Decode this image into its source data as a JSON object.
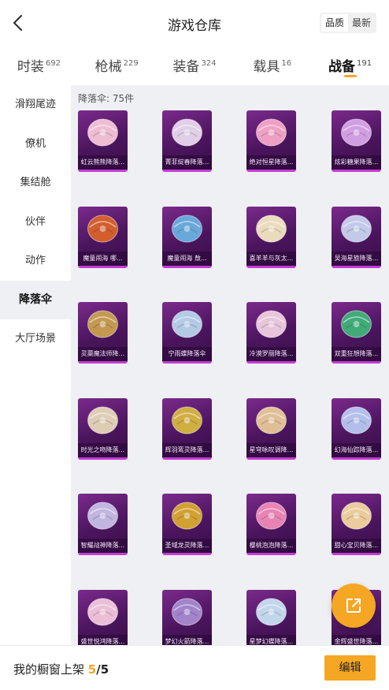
{
  "header": {
    "title": "游戏仓库",
    "sort_options": [
      "品质",
      "最新"
    ]
  },
  "tabs": [
    {
      "label": "时装",
      "count": "692"
    },
    {
      "label": "枪械",
      "count": "229"
    },
    {
      "label": "装备",
      "count": "324"
    },
    {
      "label": "载具",
      "count": "16"
    },
    {
      "label": "战备",
      "count": "191"
    }
  ],
  "sidebar": {
    "items": [
      "滑翔尾迹",
      "僚机",
      "集结舱",
      "伙伴",
      "动作",
      "降落伞",
      "大厅场景"
    ],
    "selected": "降落伞"
  },
  "content": {
    "count_text": "降落伞: 75件",
    "items": [
      {
        "name": "虹云熊熊降落...",
        "color": "#f5c6d8"
      },
      {
        "name": "菁菲綻春降落...",
        "color": "#e8d9ee"
      },
      {
        "name": "绝对恒星降落...",
        "color": "#f7a8c8"
      },
      {
        "name": "炫彩糖果降落...",
        "color": "#d7a6e8"
      },
      {
        "name": "魔童闹海 哪...",
        "color": "#d9622b"
      },
      {
        "name": "魔童闹海 敖...",
        "color": "#6ab0e0"
      },
      {
        "name": "喜羊羊与灰太...",
        "color": "#f3e6c2"
      },
      {
        "name": "吴海星旅降落...",
        "color": "#c9d3f0"
      },
      {
        "name": "灵蕖魔法师降...",
        "color": "#c9a050"
      },
      {
        "name": "宁雨蝶降落伞",
        "color": "#b8d4ec"
      },
      {
        "name": "冷漠罗丽降落...",
        "color": "#f0cfe2"
      },
      {
        "name": "双重狂想降落...",
        "color": "#3fb37a"
      },
      {
        "name": "时光之吻降落...",
        "color": "#e6d7b8"
      },
      {
        "name": "辉羽鸾灵降落...",
        "color": "#d6b640"
      },
      {
        "name": "星穹咏叹调降...",
        "color": "#e8c89a"
      },
      {
        "name": "幻海仙踪降落...",
        "color": "#b8c8f2"
      },
      {
        "name": "智耀战神降落...",
        "color": "#c7bfe6"
      },
      {
        "name": "圣域龙灵降落...",
        "color": "#d8a930"
      },
      {
        "name": "樱桃泡泡降落...",
        "color": "#f08ab8"
      },
      {
        "name": "甜心宝贝降落...",
        "color": "#f2d6a0"
      },
      {
        "name": "盛世悦鸿降落...",
        "color": "#f2c8dc"
      },
      {
        "name": "梦幻火箭降落...",
        "color": "#a58ad0"
      },
      {
        "name": "星梦幻蝶降落...",
        "color": "#c8e0f2"
      },
      {
        "name": "金辉盛世降落...",
        "color": "#e6c070"
      }
    ]
  },
  "bottom": {
    "showcase_label": "我的橱窗上架",
    "current": "5",
    "total": "/5",
    "edit_label": "编辑"
  },
  "colors": {
    "accent": "#f5a623",
    "card_bg": "#5a1a6e",
    "card_border": "#c43bd6"
  }
}
